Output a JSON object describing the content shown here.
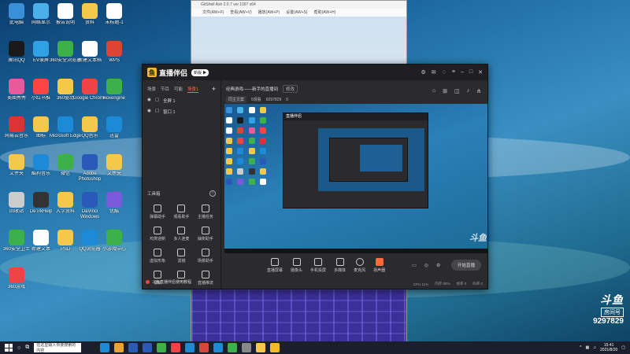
{
  "desktop": {
    "icons": [
      {
        "label": "此电脑",
        "color": "#3a8fd9"
      },
      {
        "label": "网络显示",
        "color": "#4ab0e8"
      },
      {
        "label": "报告说明",
        "color": "#ffffff"
      },
      {
        "label": "资料",
        "color": "#f4c84a"
      },
      {
        "label": "未标题-1",
        "color": "#ffffff"
      },
      {
        "label": "腾讯QQ",
        "color": "#1a1a1a"
      },
      {
        "label": "EV录屏",
        "color": "#2fa2e5"
      },
      {
        "label": "360安全浏览器",
        "color": "#3cb04a"
      },
      {
        "label": "新建文本档",
        "color": "#ffffff"
      },
      {
        "label": "WPS",
        "color": "#d43"
      },
      {
        "label": "美图秀秀",
        "color": "#e85a9c"
      },
      {
        "label": "小红书推",
        "color": "#f44"
      },
      {
        "label": "360驱动",
        "color": "#f4c84a"
      },
      {
        "label": "Google Chrome",
        "color": "#e44"
      },
      {
        "label": "Foxengine",
        "color": "#3cb04a"
      },
      {
        "label": "网易云音乐",
        "color": "#d33"
      },
      {
        "label": "图标",
        "color": "#f4c84a"
      },
      {
        "label": "Microsoft Edge",
        "color": "#1c8ad6"
      },
      {
        "label": "QQ音乐",
        "color": "#f4c84a"
      },
      {
        "label": "迅雷",
        "color": "#1c8ad6"
      },
      {
        "label": "文件夹",
        "color": "#f4c84a"
      },
      {
        "label": "酷狗音乐",
        "color": "#1c8ad6"
      },
      {
        "label": "微信",
        "color": "#3cb04a"
      },
      {
        "label": "Adobe Photoshop",
        "color": "#2a5ab8"
      },
      {
        "label": "文件夹",
        "color": "#f4c84a"
      },
      {
        "label": "回收站",
        "color": "#cccccc"
      },
      {
        "label": "DeTrkHelp",
        "color": "#333333"
      },
      {
        "label": "入学资料",
        "color": "#f4c84a"
      },
      {
        "label": "DaVinci Windows",
        "color": "#2a5ab8"
      },
      {
        "label": "优酷",
        "color": "#7a5ad9"
      },
      {
        "label": "360安全卫士",
        "color": "#3cb04a"
      },
      {
        "label": "新建文本",
        "color": "#ffffff"
      },
      {
        "label": "PSD",
        "color": "#f4c84a"
      },
      {
        "label": "QQ浏览器",
        "color": "#1c8ad6"
      },
      {
        "label": "小游戏中心",
        "color": "#3cb04a"
      },
      {
        "label": "360游戏",
        "color": "#e44"
      }
    ]
  },
  "player": {
    "title": "GitShell Ash 2.0.7 ver.1097 x64",
    "menu": [
      "文件(AW+F)",
      "查看(AW+V)",
      "播放(AW+P)",
      "设置(AW+S)",
      "帮助(AW+H)"
    ]
  },
  "obs": {
    "app_name": "直播伴侣",
    "version": "新版 ▶",
    "tabs": [
      "场景",
      "节目",
      "可能",
      "场景1"
    ],
    "scenes": [
      "全屏 1",
      "窗口 1"
    ],
    "tools_title": "工具箱",
    "tools": [
      "弹幕助手",
      "观看助手",
      "主播任务",
      "鸡贺迎新",
      "多人连麦",
      "抽奖助手",
      "虚拟形象",
      "滤镜",
      "场景助手",
      "录制",
      "",
      "直播推流"
    ],
    "notice": "斗鱼直播伴侣使用教程",
    "room_title": "经典游戏——新手的直播间",
    "room_btn": "修改",
    "stat_a": "同主文案",
    "stat_b": "5观看",
    "stat_c": "9297829",
    "stat_d": "0",
    "controls": [
      "直播屏幕",
      "摄像头",
      "手机投屏",
      "多媒体",
      "麦克风",
      "扬声器"
    ],
    "live_label": "开始直播",
    "status": [
      "CPU 11%",
      "内存 58%",
      "帧率 0",
      "码率 0"
    ]
  },
  "watermark": {
    "brand": "斗鱼",
    "room_label": "房间号",
    "room_number": "9297829"
  },
  "taskbar": {
    "search_placeholder": "在这里输入你要搜索的内容",
    "time": "15:41",
    "date": "2021/8/20",
    "apps": [
      "#1c8ad6",
      "#e8a33c",
      "#2a5ab8",
      "#2a5ab8",
      "#3cb04a",
      "#e44",
      "#1c8ad6",
      "#d4453b",
      "#1c8ad6",
      "#3cb04a",
      "#888",
      "#f4c84a",
      "#f3b92b"
    ]
  }
}
